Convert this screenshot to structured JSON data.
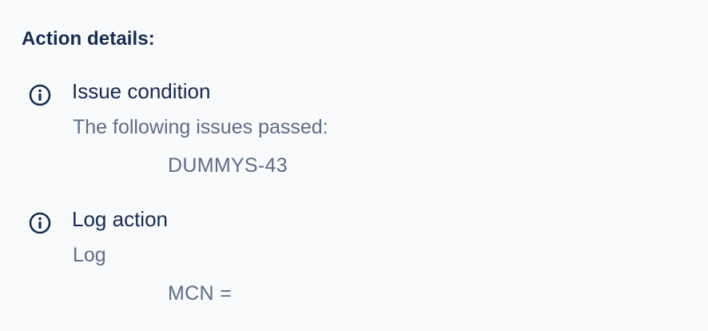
{
  "section": {
    "heading": "Action details:"
  },
  "entries": [
    {
      "icon": "info-icon",
      "title": "Issue condition",
      "subtitle": "The following issues passed:",
      "value": "DUMMYS-43"
    },
    {
      "icon": "info-icon",
      "title": "Log action",
      "subtitle": "Log",
      "value": "MCN ="
    }
  ],
  "colors": {
    "background": "#f9fafc",
    "primary_text": "#172b4d",
    "secondary_text": "#5e6c84"
  }
}
